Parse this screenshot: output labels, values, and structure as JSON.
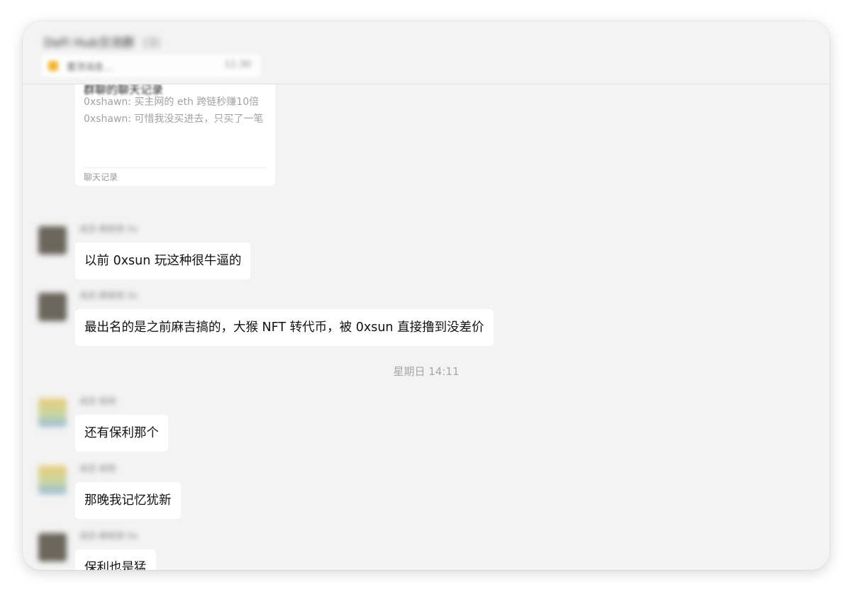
{
  "window": {
    "chat_title": "DeFi Hub交流群",
    "member_count": "(3)",
    "pinned": {
      "text": "置顶消息…",
      "time": "11:30"
    }
  },
  "forwarded_record": {
    "heading": "群聊的聊天记录",
    "lines": [
      "0xshawn: 买主网的 eth 跨链秒赚10倍",
      "0xshawn: 可惜我没买进去，只买了一笔"
    ],
    "footer": "聊天记录"
  },
  "messages": [
    {
      "sender": "成员·群昵称 0x",
      "text": "以前 0xsun 玩这种很牛逼的",
      "avatar": "dark"
    },
    {
      "sender": "成员·群昵称 0x",
      "text": "最出名的是之前麻吉搞的，大猴 NFT 转代币，被 0xsun 直接撸到没差价",
      "avatar": "dark"
    },
    {
      "sender": "成员 昵称",
      "text": "还有保利那个",
      "avatar": "light"
    },
    {
      "sender": "成员 昵称",
      "text": "那晚我记忆犹新",
      "avatar": "light"
    },
    {
      "sender": "成员·群昵称 0x",
      "text": "保利也是猛",
      "avatar": "dark"
    }
  ],
  "timestamp": "星期日 14:11",
  "colors": {
    "window_bg": "#f3f3f3",
    "bubble_bg": "#ffffff",
    "timestamp_text": "#a6a6a6",
    "pin_icon": "#f3b531"
  }
}
